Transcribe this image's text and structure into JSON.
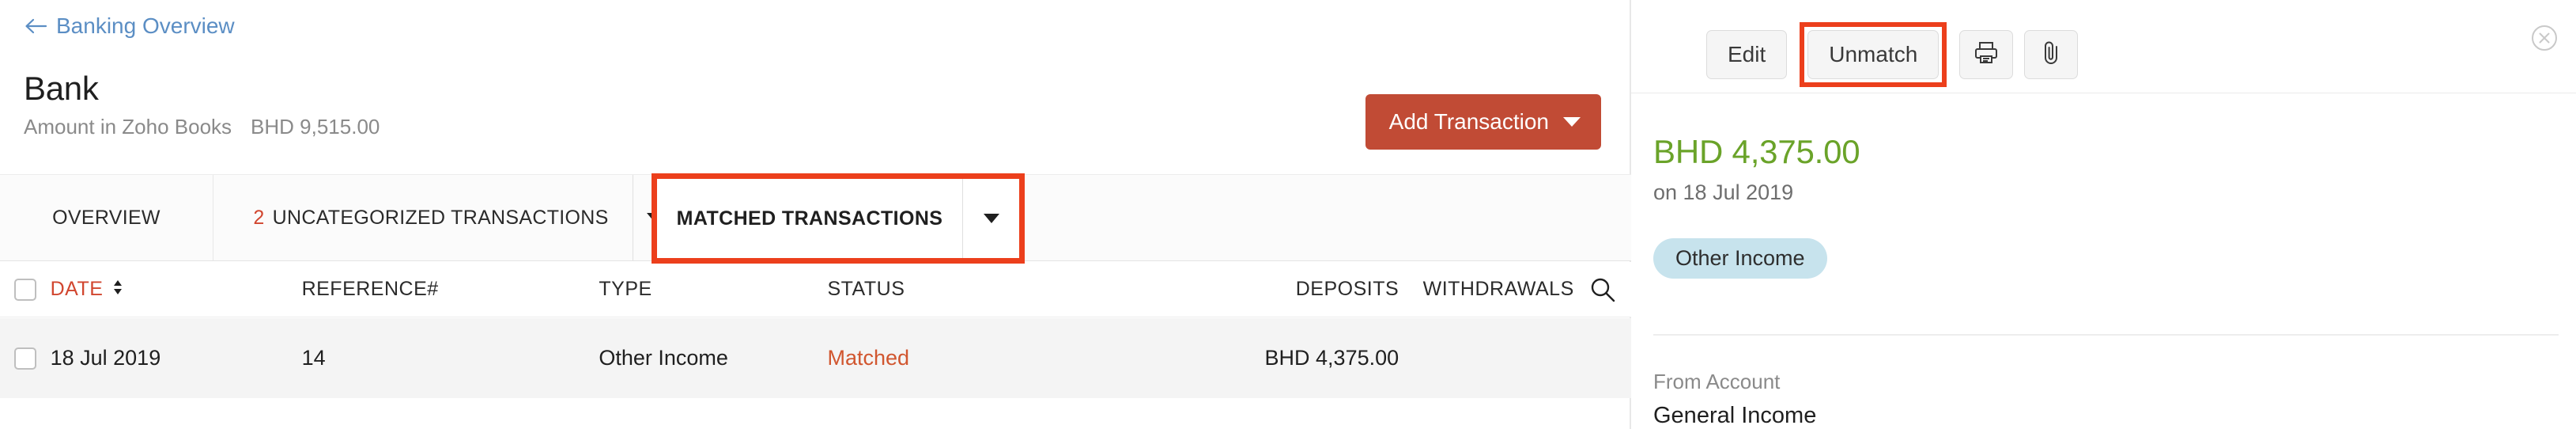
{
  "breadcrumb": {
    "back_label": "Banking Overview",
    "back_icon": "arrow-left-icon",
    "color": "#5b8ec4"
  },
  "header": {
    "title": "Bank",
    "subtitle_label": "Amount in Zoho Books",
    "subtitle_amount": "BHD 9,515.00",
    "add_button": {
      "label": "Add Transaction",
      "caret_icon": "caret-down-icon",
      "color": "#c14b35"
    }
  },
  "tabs": [
    {
      "label": "OVERVIEW",
      "selected": false,
      "has_dropdown": false
    },
    {
      "label": "UNCATEGORIZED TRANSACTIONS",
      "count": "2",
      "selected": false,
      "has_dropdown": true
    },
    {
      "label": "MATCHED TRANSACTIONS",
      "selected": true,
      "has_dropdown": true,
      "highlight_color": "#ec3f1c"
    }
  ],
  "table": {
    "select_all_checkbox": "checkbox-icon",
    "search_icon": "search-icon",
    "sort_icon": "sort-arrow-icon",
    "columns": [
      {
        "key": "date",
        "label": "DATE",
        "sorted": true
      },
      {
        "key": "reference",
        "label": "REFERENCE#"
      },
      {
        "key": "type",
        "label": "TYPE"
      },
      {
        "key": "status",
        "label": "STATUS"
      },
      {
        "key": "deposits",
        "label": "DEPOSITS"
      },
      {
        "key": "withdrawals",
        "label": "WITHDRAWALS"
      }
    ],
    "rows": [
      {
        "date": "18 Jul 2019",
        "reference": "14",
        "type": "Other Income",
        "status": "Matched",
        "deposits": "BHD 4,375.00",
        "withdrawals": "",
        "selected": true,
        "highlight_color": "#ec3f1c"
      }
    ]
  },
  "detail_panel": {
    "toolbar": {
      "edit_label": "Edit",
      "unmatch_label": "Unmatch",
      "unmatch_highlight_color": "#ec3f1c",
      "print_icon": "printer-icon",
      "attachment_icon": "paperclip-icon",
      "close_icon": "close-circle-icon"
    },
    "amount": "BHD 4,375.00",
    "amount_color": "#6aa329",
    "date_line": "on 18 Jul 2019",
    "category_badge": "Other Income",
    "badge_color": "#c7e3ed",
    "from_account_label": "From Account",
    "from_account_value": "General Income"
  }
}
